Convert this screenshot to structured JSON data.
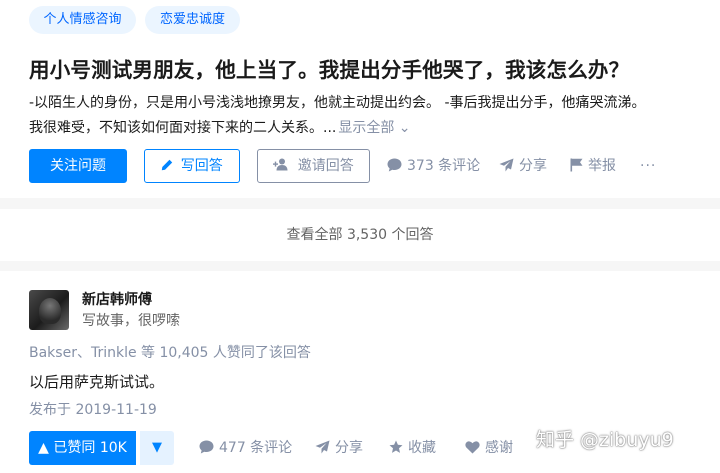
{
  "topics": [
    "个人情感咨询",
    "恋爱忠诚度"
  ],
  "question": {
    "title": "用小号测试男朋友，他上当了。我提出分手他哭了，我该怎么办？",
    "excerpt_line1": "-以陌生人的身份，只是用小号浅浅地撩男友，他就主动提出约会。 -事后我提出分手，他痛哭流涕。",
    "excerpt_line2": "我很难受，不知该如何面对接下来的二人关系。...",
    "show_all": "显示全部 ⌄"
  },
  "question_actions": {
    "follow": "关注问题",
    "write": "写回答",
    "invite": "邀请回答",
    "comments": "373 条评论",
    "share": "分享",
    "report": "举报",
    "more": "···"
  },
  "view_all": "查看全部 3,530 个回答",
  "answer": {
    "author_name": "新店韩师傅",
    "author_bio": "写故事，很啰嗦",
    "upvoters": "Bakser、Trinkle 等 10,405 人赞同了该回答",
    "text": "以后用萨克斯试试。",
    "date": "发布于 2019-11-19"
  },
  "answer_actions": {
    "upvote": "▲ 已赞同 10K",
    "downvote": "▼",
    "comments": "477 条评论",
    "share": "分享",
    "collect": "收藏",
    "thanks": "感谢"
  },
  "watermark": "知乎 @zibuyu9",
  "icons": {
    "comment": "comment-icon",
    "share": "paper-plane-icon",
    "report": "flag-icon",
    "pen": "pen-icon",
    "invite": "add-user-icon",
    "collect": "star-icon",
    "thanks": "heart-icon"
  },
  "colors": {
    "primary": "#0084ff",
    "topic_bg": "#ebf5ff",
    "gray_text": "#8590a6"
  }
}
